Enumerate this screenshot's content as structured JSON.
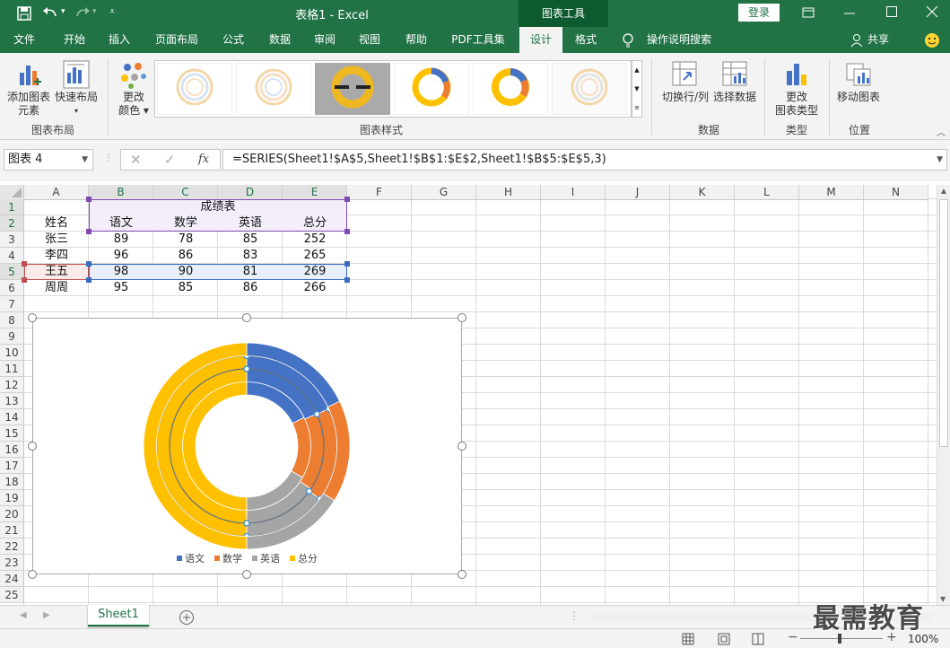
{
  "titlebar": {
    "title": "表格1  -  Excel",
    "context_tab": "图表工具",
    "login": "登录"
  },
  "tabs": [
    "文件",
    "开始",
    "插入",
    "页面布局",
    "公式",
    "数据",
    "审阅",
    "视图",
    "帮助",
    "PDF工具集",
    "设计",
    "格式"
  ],
  "tell_me": "操作说明搜索",
  "share": "共享",
  "ribbon": {
    "add_element_line1": "添加图表",
    "add_element_line2": "元素",
    "quick_layout": "快速布局",
    "change_color_line1": "更改",
    "change_color_line2": "颜色",
    "group_layout": "图表布局",
    "group_styles": "图表样式",
    "switch_rowcol": "切换行/列",
    "select_data": "选择数据",
    "group_data": "数据",
    "change_type_line1": "更改",
    "change_type_line2": "图表类型",
    "group_type": "类型",
    "move_chart": "移动图表",
    "group_location": "位置"
  },
  "formula": {
    "name_box": "图表 4",
    "fx": "fx",
    "content": "=SERIES(Sheet1!$A$5,Sheet1!$B$1:$E$2,Sheet1!$B$5:$E$5,3)"
  },
  "columns": [
    "A",
    "B",
    "C",
    "D",
    "E",
    "F",
    "G",
    "H",
    "I",
    "J",
    "K",
    "L",
    "M",
    "N"
  ],
  "rows": [
    "1",
    "2",
    "3",
    "4",
    "5",
    "6",
    "7",
    "8",
    "9",
    "10",
    "11",
    "12",
    "13",
    "14",
    "15",
    "16",
    "17",
    "18",
    "19",
    "20",
    "21",
    "22",
    "23",
    "24",
    "25"
  ],
  "table": {
    "title": "成绩表",
    "headers": [
      "姓名",
      "语文",
      "数学",
      "英语",
      "总分"
    ],
    "data": [
      [
        "张三",
        "89",
        "78",
        "85",
        "252"
      ],
      [
        "李四",
        "96",
        "86",
        "83",
        "265"
      ],
      [
        "王五",
        "98",
        "90",
        "81",
        "269"
      ],
      [
        "周周",
        "95",
        "85",
        "86",
        "266"
      ]
    ]
  },
  "chart_data": {
    "type": "pie",
    "subtype": "doughnut",
    "categories": [
      "语文",
      "数学",
      "英语",
      "总分"
    ],
    "series": [
      {
        "name": "张三",
        "values": [
          89,
          78,
          85,
          252
        ]
      },
      {
        "name": "李四",
        "values": [
          96,
          86,
          83,
          265
        ]
      },
      {
        "name": "王五",
        "values": [
          98,
          90,
          81,
          269
        ]
      },
      {
        "name": "周周",
        "values": [
          95,
          85,
          86,
          266
        ]
      }
    ],
    "colors": [
      "#4472c4",
      "#ed7d31",
      "#a5a5a5",
      "#ffc000"
    ],
    "selected_series": "王五",
    "legend": "bottom"
  },
  "sheet_tab": "Sheet1",
  "zoom": "100%",
  "watermark": "最需教育"
}
